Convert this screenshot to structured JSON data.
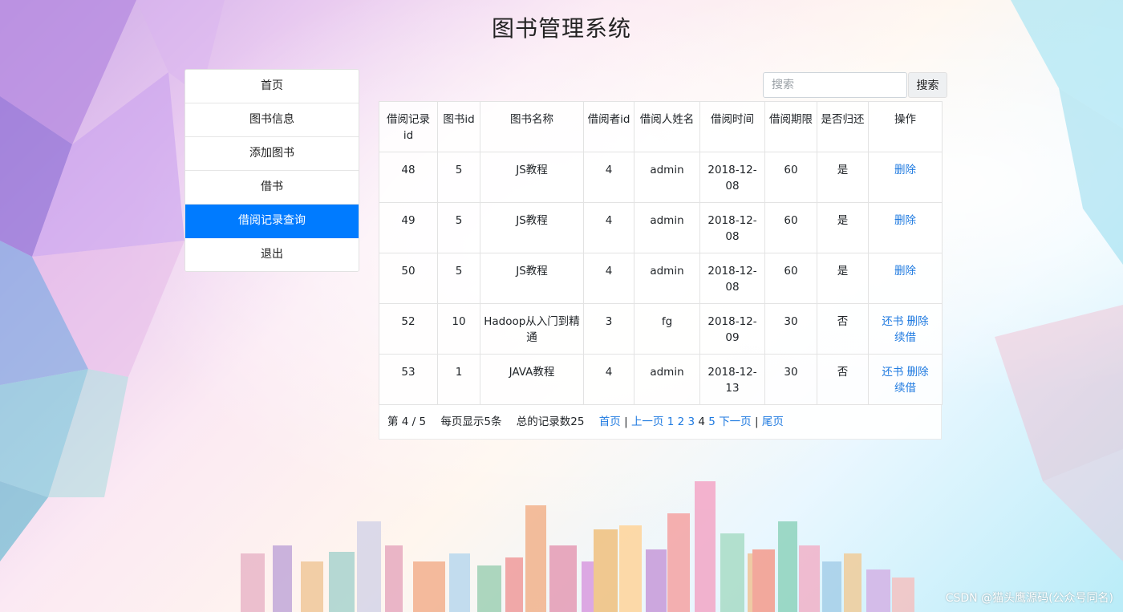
{
  "header": {
    "title": "图书管理系统"
  },
  "sidebar": {
    "items": [
      {
        "label": "首页"
      },
      {
        "label": "图书信息"
      },
      {
        "label": "添加图书"
      },
      {
        "label": "借书"
      },
      {
        "label": "借阅记录查询",
        "active": true
      },
      {
        "label": "退出"
      }
    ]
  },
  "search": {
    "placeholder": "搜索",
    "button_label": "搜索"
  },
  "table": {
    "headers": [
      "借阅记录id",
      "图书id",
      "图书名称",
      "借阅者id",
      "借阅人姓名",
      "借阅时间",
      "借阅期限",
      "是否归还",
      "操作"
    ],
    "rows": [
      {
        "record_id": "48",
        "book_id": "5",
        "book_name": "JS教程",
        "borrower_id": "4",
        "borrower_name": "admin",
        "borrow_time": "2018-12-08",
        "period": "60",
        "returned": "是",
        "actions": [
          "删除"
        ]
      },
      {
        "record_id": "49",
        "book_id": "5",
        "book_name": "JS教程",
        "borrower_id": "4",
        "borrower_name": "admin",
        "borrow_time": "2018-12-08",
        "period": "60",
        "returned": "是",
        "actions": [
          "删除"
        ]
      },
      {
        "record_id": "50",
        "book_id": "5",
        "book_name": "JS教程",
        "borrower_id": "4",
        "borrower_name": "admin",
        "borrow_time": "2018-12-08",
        "period": "60",
        "returned": "是",
        "actions": [
          "删除"
        ]
      },
      {
        "record_id": "52",
        "book_id": "10",
        "book_name": "Hadoop从入门到精通",
        "borrower_id": "3",
        "borrower_name": "fg",
        "borrow_time": "2018-12-09",
        "period": "30",
        "returned": "否",
        "actions": [
          "还书",
          "删除",
          "续借"
        ]
      },
      {
        "record_id": "53",
        "book_id": "1",
        "book_name": "JAVA教程",
        "borrower_id": "4",
        "borrower_name": "admin",
        "borrow_time": "2018-12-13",
        "period": "30",
        "returned": "否",
        "actions": [
          "还书",
          "删除",
          "续借"
        ]
      }
    ]
  },
  "pagination": {
    "page_info": "第 4 / 5",
    "per_page": "每页显示5条",
    "total": "总的记录数25",
    "first": "首页",
    "prev": "上一页",
    "pages": [
      "1",
      "2",
      "3",
      "4",
      "5"
    ],
    "current_page": "4",
    "next": "下一页",
    "last": "尾页",
    "separator": "|"
  },
  "watermark": "CSDN @猫头鹰源码(公众号同名)",
  "colors": {
    "accent": "#007bff",
    "link": "#1f7ae0"
  }
}
